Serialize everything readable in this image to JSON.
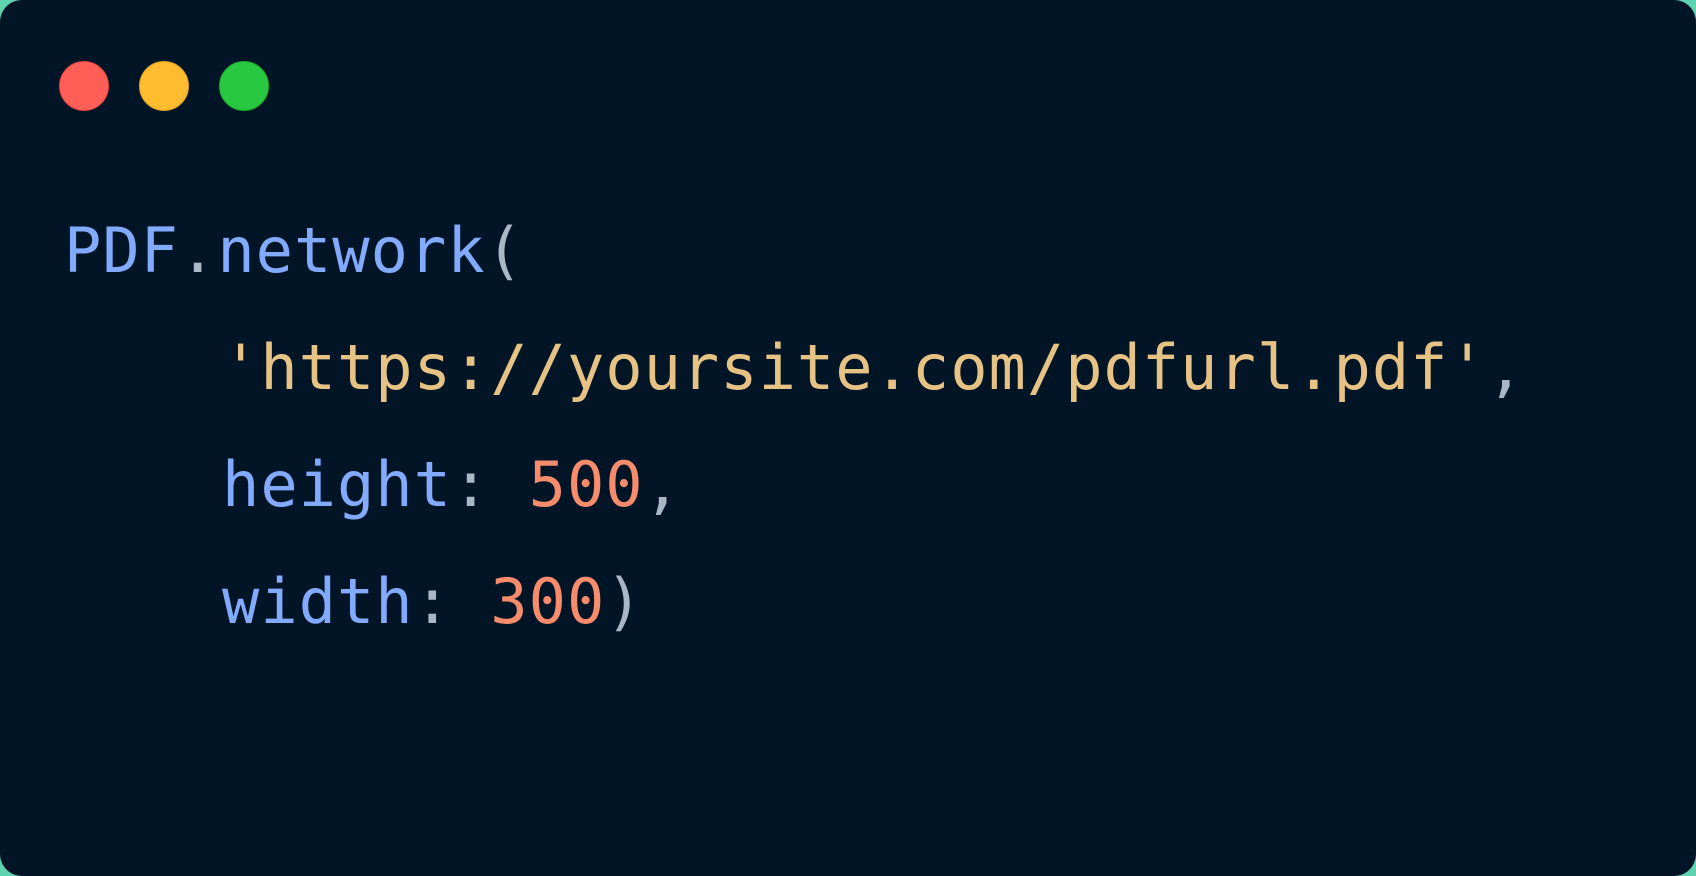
{
  "window": {
    "controls": [
      {
        "name": "close",
        "color": "#ff5f57"
      },
      {
        "name": "minimize",
        "color": "#febc2e"
      },
      {
        "name": "maximize",
        "color": "#28c840"
      }
    ]
  },
  "code": {
    "line1": {
      "object": "PDF",
      "dot": ".",
      "method": "network",
      "open_paren": "("
    },
    "line2": {
      "string": "'https://yoursite.com/pdfurl.pdf'",
      "comma": ","
    },
    "line3": {
      "key": "height",
      "colon": ":",
      "value": "500",
      "comma": ","
    },
    "line4": {
      "key": "width",
      "colon": ":",
      "value": "300",
      "close_paren": ")"
    }
  },
  "colors": {
    "background": "#021526",
    "function": "#82aaff",
    "string": "#e6c384",
    "number": "#f78c6c",
    "punctuation": "#a9b7c6"
  }
}
